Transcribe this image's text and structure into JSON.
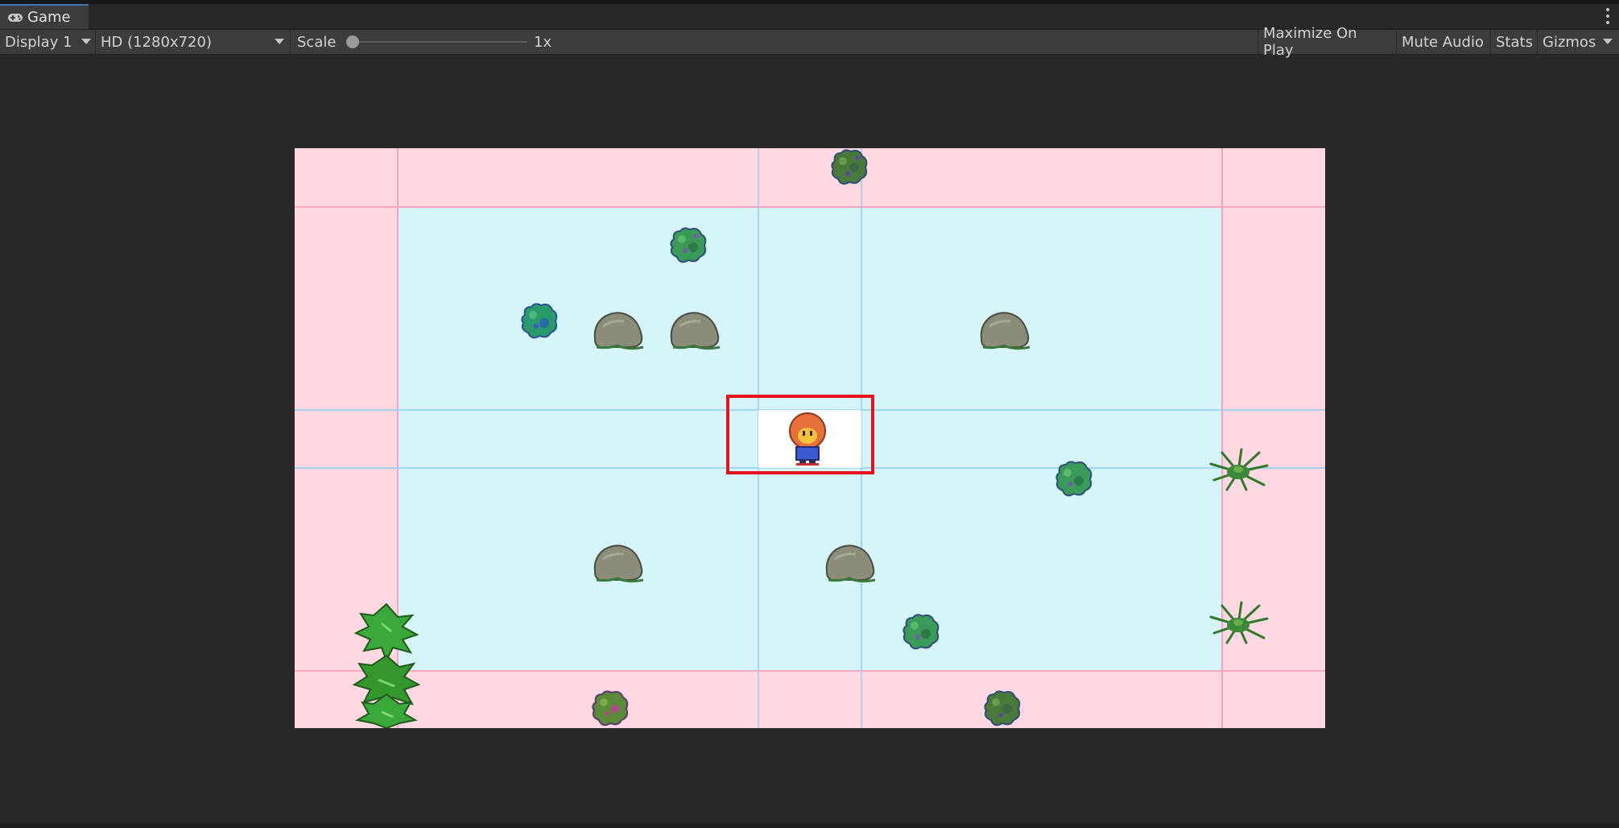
{
  "window": {
    "tab_label": "Game",
    "tab_icon": "gamepad-icon"
  },
  "toolbar": {
    "display_select": "Display 1",
    "resolution_select": "HD (1280x720)",
    "scale_label": "Scale",
    "scale_value": "1x",
    "scale_fraction": 0.0,
    "maximize_on_play": "Maximize On Play",
    "mute_audio": "Mute Audio",
    "stats": "Stats",
    "gizmos": "Gizmos"
  },
  "colors": {
    "editor_background": "#282828",
    "toolbar_background": "#3c3c3c",
    "tab_accent": "#3a79bb",
    "outside_camera": "#ffd8e2",
    "camera_area": "#d6f5fb",
    "selection_outline": "#e8101a",
    "highlight_cell": "#ffffff"
  },
  "game": {
    "player": "player-character",
    "sprites": [
      "bush",
      "rock",
      "fern",
      "tree"
    ]
  }
}
